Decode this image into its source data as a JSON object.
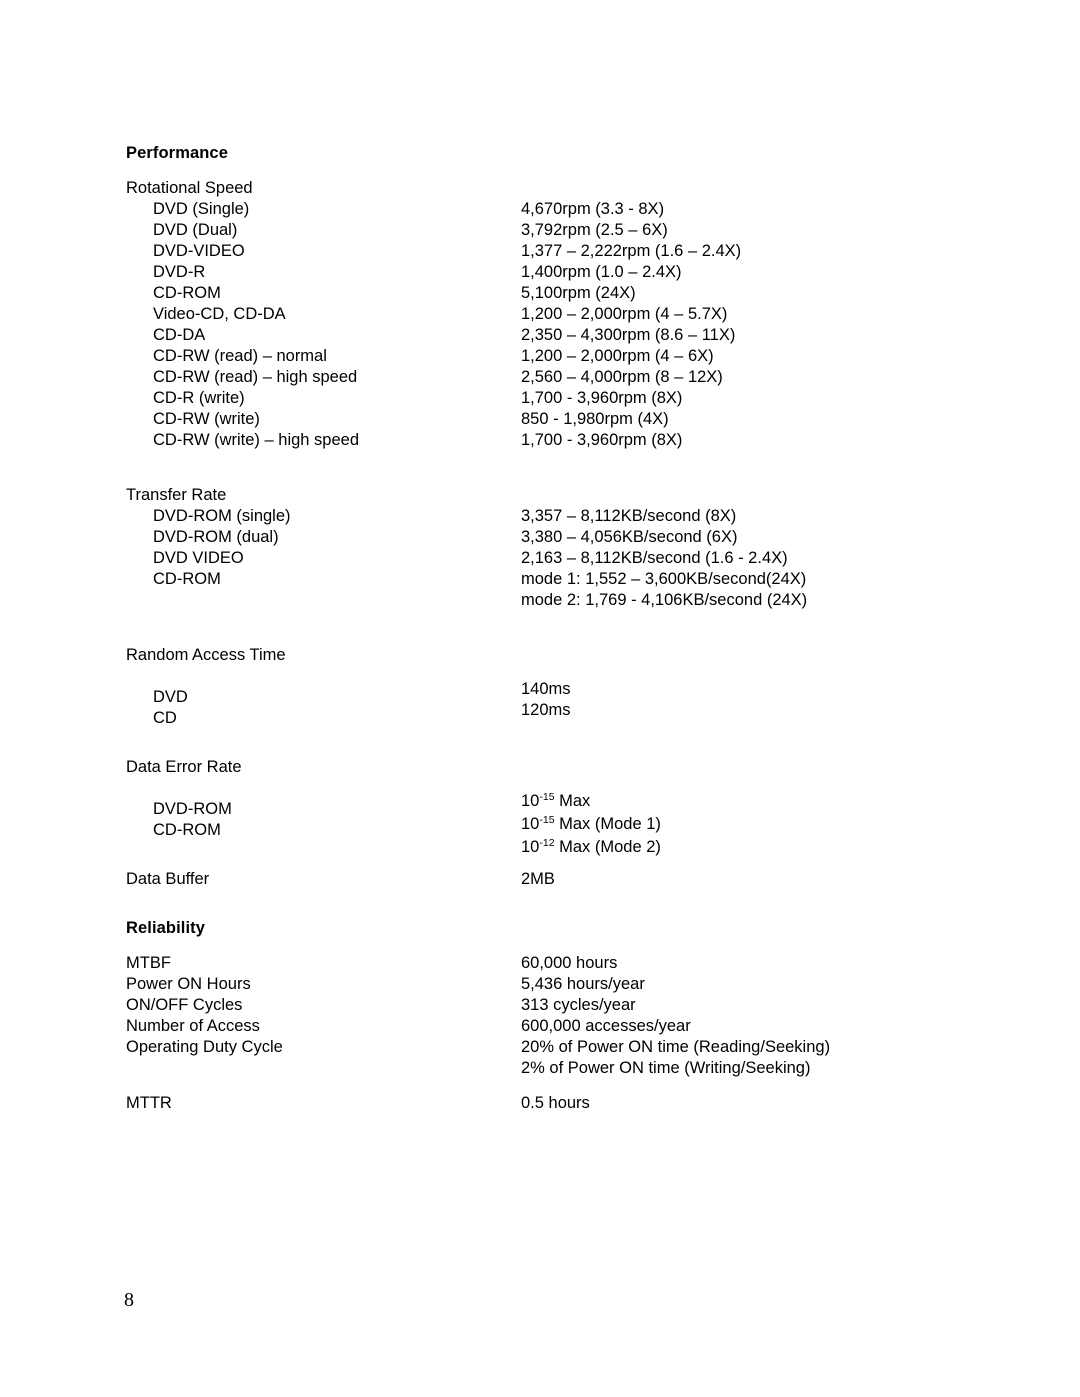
{
  "page": {
    "number": "8"
  },
  "sections": [
    {
      "heading": "Performance",
      "groups": [
        {
          "title": "Rotational Speed",
          "rows": [
            {
              "label": "DVD (Single)",
              "value": "4,670rpm (3.3 - 8X)"
            },
            {
              "label": "DVD (Dual)",
              "value": "3,792rpm (2.5 – 6X)"
            },
            {
              "label": "DVD-VIDEO",
              "value": "1,377 – 2,222rpm (1.6 – 2.4X)"
            },
            {
              "label": "DVD-R",
              "value": "1,400rpm (1.0 – 2.4X)"
            },
            {
              "label": "CD-ROM",
              "value": "5,100rpm (24X)"
            },
            {
              "label": "Video-CD, CD-DA",
              "value": "1,200 – 2,000rpm (4 – 5.7X)"
            },
            {
              "label": "CD-DA",
              "value": "2,350 – 4,300rpm (8.6 – 11X)"
            },
            {
              "label": "CD-RW (read) – normal",
              "value": "1,200 – 2,000rpm (4 – 6X)"
            },
            {
              "label": "CD-RW (read) – high speed",
              "value": "2,560 – 4,000rpm (8 – 12X)"
            },
            {
              "label": "CD-R (write)",
              "value": "1,700 - 3,960rpm (8X)"
            },
            {
              "label": "CD-RW (write)",
              "value": "850 - 1,980rpm (4X)"
            },
            {
              "label": "CD-RW (write) – high speed",
              "value": "1,700 - 3,960rpm (8X)"
            }
          ]
        },
        {
          "title": "Transfer Rate",
          "rows": [
            {
              "label": "DVD-ROM (single)",
              "value": "3,357 – 8,112KB/second (8X)"
            },
            {
              "label": "DVD-ROM (dual)",
              "value": "3,380 – 4,056KB/second (6X)"
            },
            {
              "label": "DVD VIDEO",
              "value": "2,163 – 8,112KB/second (1.6 - 2.4X)"
            },
            {
              "label": "CD-ROM",
              "value": "mode 1: 1,552 – 3,600KB/second(24X)"
            },
            {
              "label": "",
              "value": "mode 2: 1,769 - 4,106KB/second (24X)"
            }
          ]
        },
        {
          "title": "Random Access Time",
          "labels": [
            "DVD",
            "CD"
          ],
          "values": [
            "140ms",
            "120ms"
          ]
        },
        {
          "title": "Data Error Rate",
          "labels": [
            "DVD-ROM",
            "CD-ROM"
          ],
          "values_rich": [
            {
              "base": "10",
              "exp": "-15",
              "tail": " Max"
            },
            {
              "base": "10",
              "exp": "-15",
              "tail": " Max (Mode 1)"
            },
            {
              "base": "10",
              "exp": "-12",
              "tail": " Max (Mode 2)"
            }
          ]
        }
      ],
      "standalone_rows": [
        {
          "label": "Data Buffer",
          "value": "2MB"
        }
      ]
    },
    {
      "heading": "Reliability",
      "rows": [
        {
          "label": "MTBF",
          "value": "60,000 hours"
        },
        {
          "label": "Power ON Hours",
          "value": "5,436 hours/year"
        },
        {
          "label": "ON/OFF Cycles",
          "value": "313 cycles/year"
        },
        {
          "label": "Number of Access",
          "value": "600,000 accesses/year"
        },
        {
          "label": "Operating Duty Cycle",
          "value": "20% of Power ON time (Reading/Seeking)"
        },
        {
          "label": "",
          "value": "2% of Power ON time (Writing/Seeking)"
        },
        {
          "label": "MTTR",
          "value": "0.5 hours"
        }
      ]
    }
  ]
}
